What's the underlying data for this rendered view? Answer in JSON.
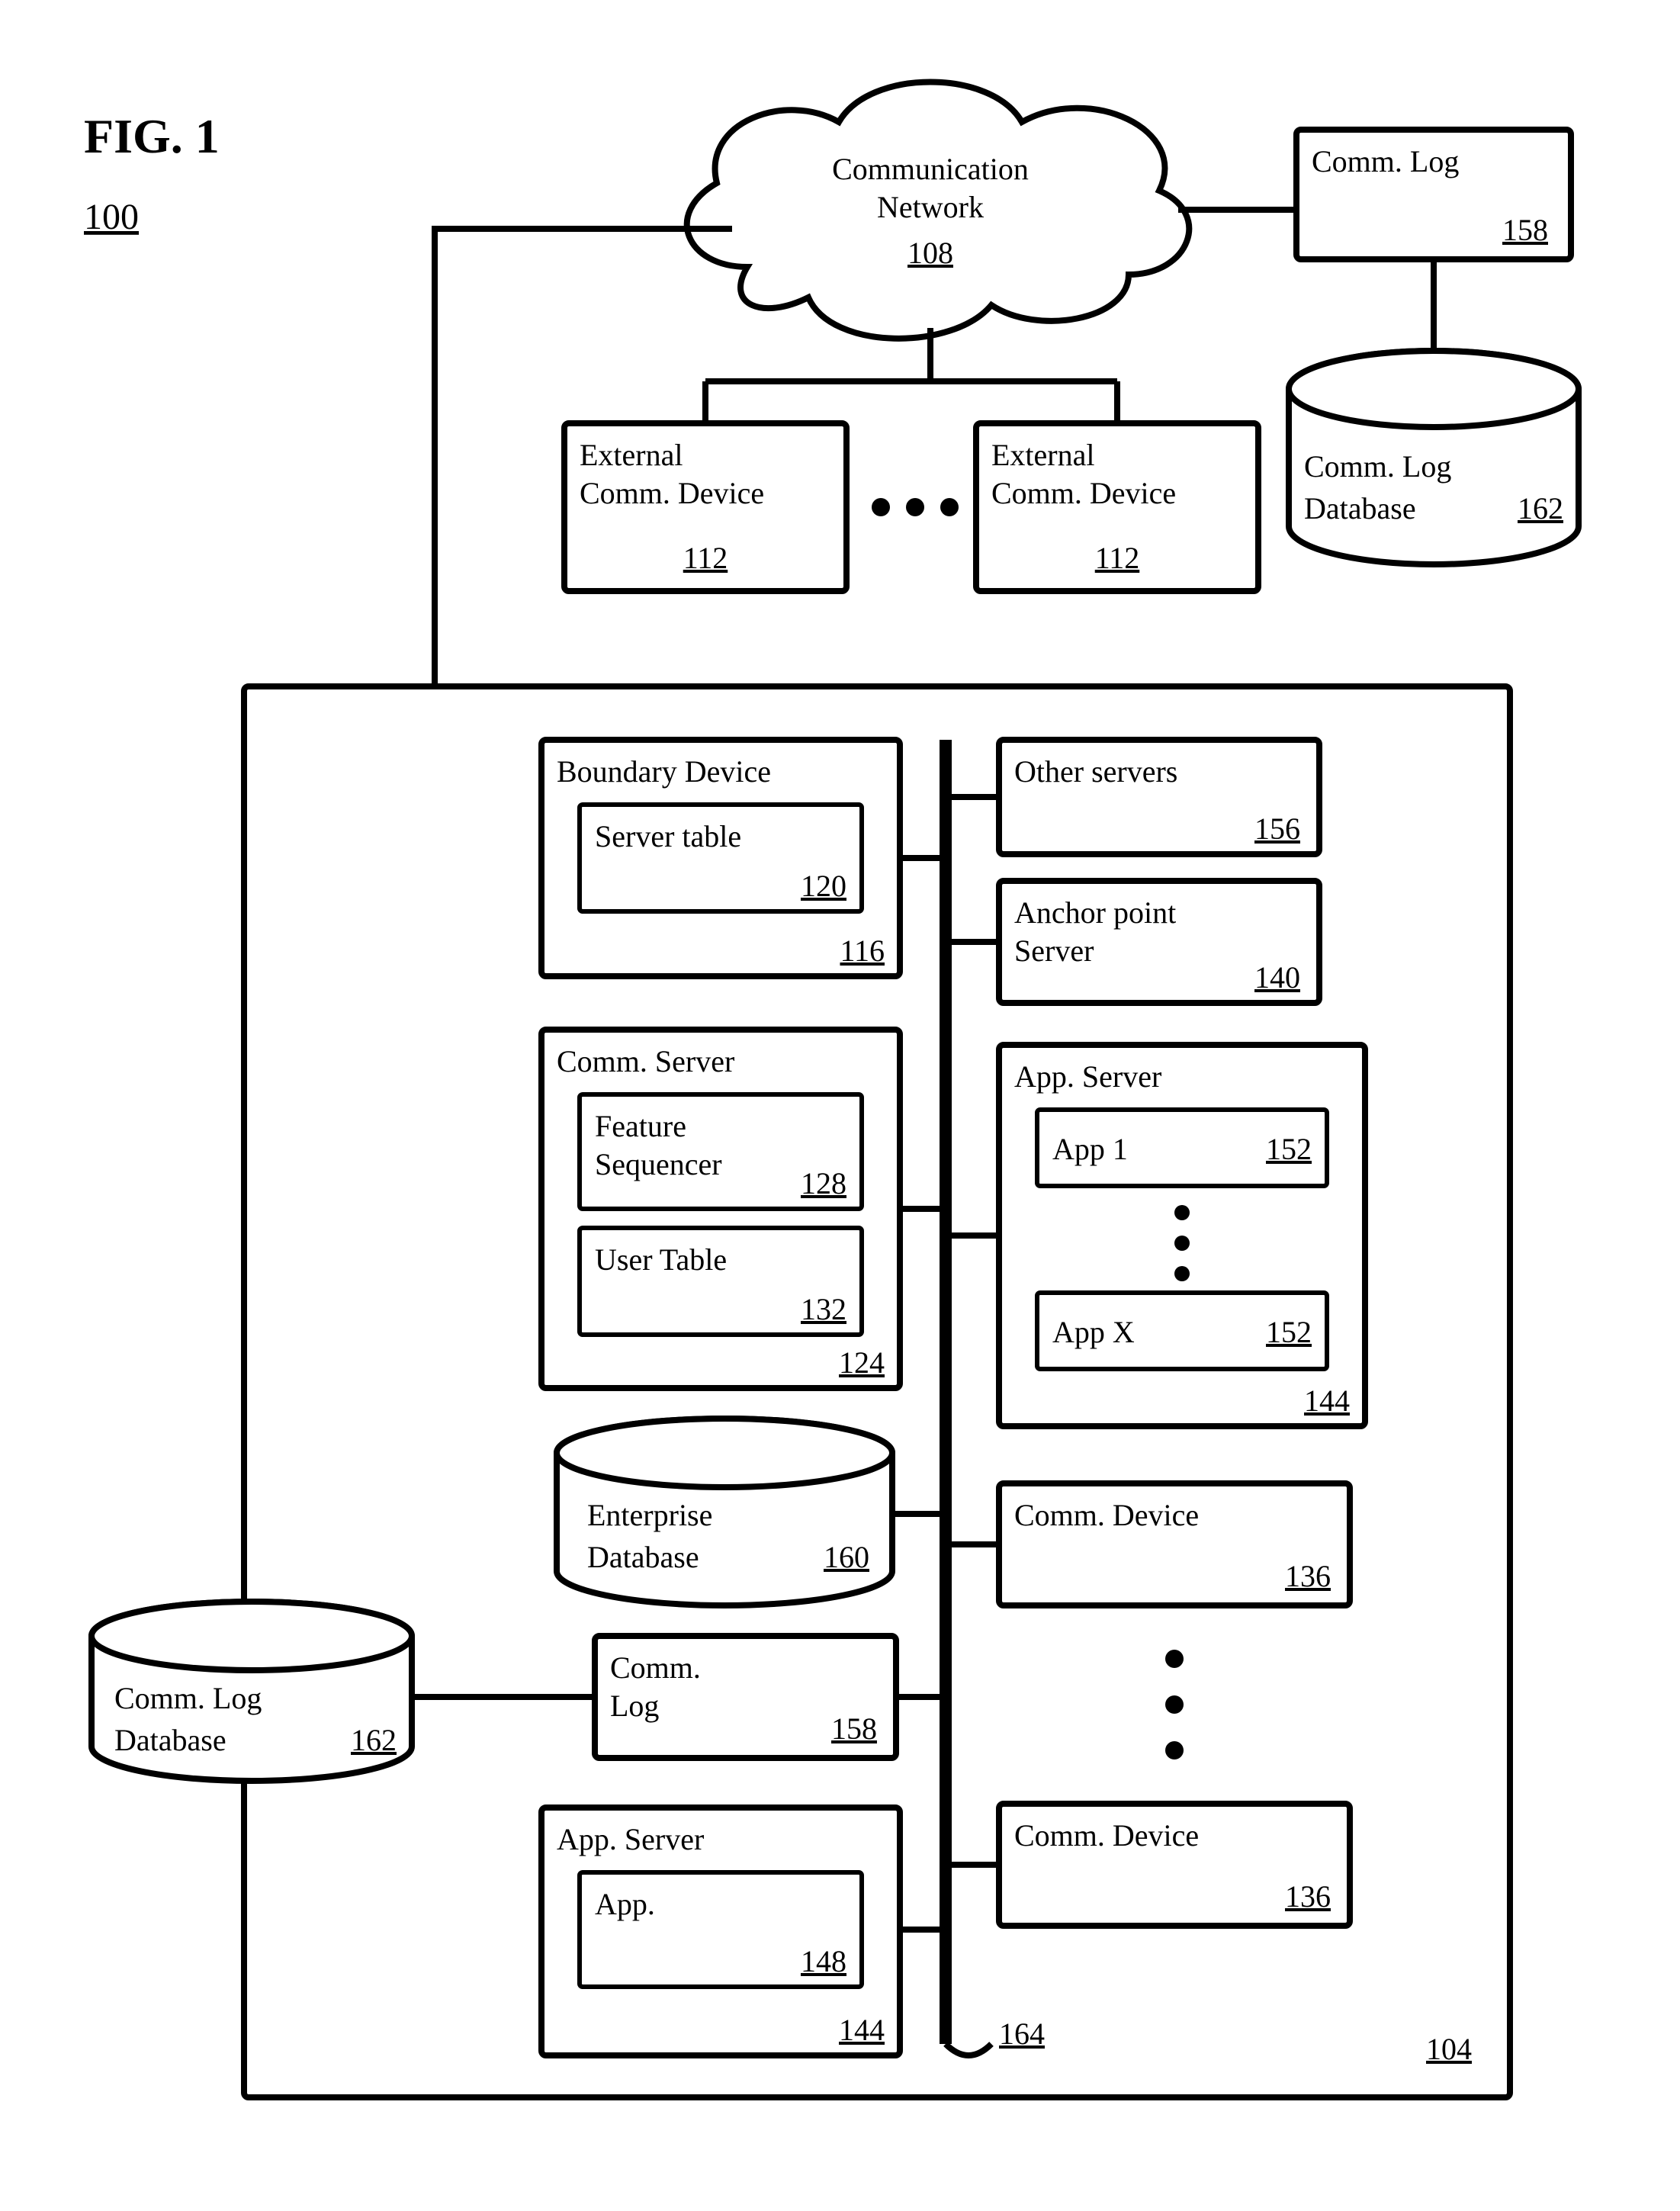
{
  "figure": {
    "title": "FIG. 1",
    "ref": "100"
  },
  "nodes": {
    "network": {
      "label1": "Communication",
      "label2": "Network",
      "ref": "108"
    },
    "commlog_top": {
      "label": "Comm. Log",
      "ref": "158"
    },
    "commlog_db_top": {
      "label1": "Comm. Log",
      "label2": "Database",
      "ref": "162"
    },
    "ext_dev_left": {
      "label1": "External",
      "label2": "Comm. Device",
      "ref": "112"
    },
    "ext_dev_right": {
      "label1": "External",
      "label2": "Comm. Device",
      "ref": "112"
    },
    "ellipsis_ext": "● ● ●",
    "enterprise_ref": "104",
    "bus_ref": "164",
    "boundary": {
      "label": "Boundary Device",
      "ref": "116"
    },
    "server_table": {
      "label": "Server table",
      "ref": "120"
    },
    "comm_server": {
      "label": "Comm. Server",
      "ref": "124"
    },
    "feature_seq": {
      "label1": "Feature",
      "label2": "Sequencer",
      "ref": "128"
    },
    "user_table": {
      "label": "User Table",
      "ref": "132"
    },
    "ent_db": {
      "label1": "Enterprise",
      "label2": "Database",
      "ref": "160"
    },
    "commlog_left": {
      "label1": "Comm.",
      "label2": "Log",
      "ref": "158"
    },
    "commlog_db_left": {
      "label1": "Comm. Log",
      "label2": "Database",
      "ref": "162"
    },
    "app_server_left": {
      "label": "App. Server",
      "ref": "144"
    },
    "app_left": {
      "label": "App.",
      "ref": "148"
    },
    "other_servers": {
      "label": "Other servers",
      "ref": "156"
    },
    "anchor_server": {
      "label1": "Anchor point",
      "label2": "Server",
      "ref": "140"
    },
    "app_server_right": {
      "label": "App. Server",
      "ref": "144"
    },
    "app1": {
      "label": "App 1",
      "ref": "152"
    },
    "appx": {
      "label": "App X",
      "ref": "152"
    },
    "comm_dev_top": {
      "label": "Comm. Device",
      "ref": "136"
    },
    "comm_dev_bot": {
      "label": "Comm. Device",
      "ref": "136"
    }
  }
}
